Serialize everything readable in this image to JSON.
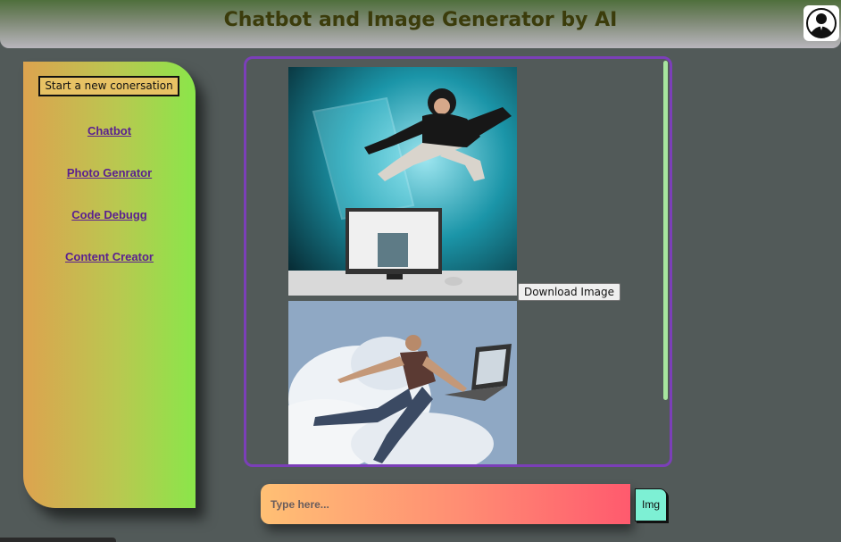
{
  "header": {
    "title": "Chatbot and Image Generator by AI",
    "avatar_icon": "user-avatar-icon"
  },
  "sidebar": {
    "new_conversation_label": "Start a new conersation",
    "items": [
      {
        "label": "Chatbot"
      },
      {
        "label": "Photo Genrator"
      },
      {
        "label": "Code Debugg"
      },
      {
        "label": "Content Creator"
      }
    ]
  },
  "chat": {
    "images": [
      {
        "description_icon": "generated-image-1"
      },
      {
        "description_icon": "generated-image-2"
      }
    ],
    "download_label": "Download Image"
  },
  "composer": {
    "placeholder": "Type here...",
    "img_button_label": "Img"
  },
  "colors": {
    "accent_border": "#7b3fb8",
    "link": "#5a2090",
    "img_button": "#7df0d4"
  }
}
